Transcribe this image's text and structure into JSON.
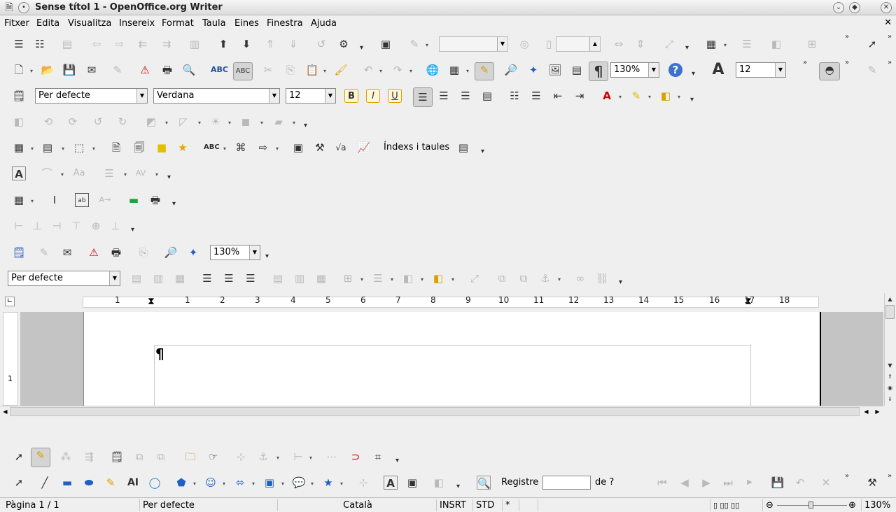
{
  "window": {
    "title": "Sense títol 1 - OpenOffice.org Writer"
  },
  "menu": {
    "items": [
      "Fitxer",
      "Edita",
      "Visualitza",
      "Insereix",
      "Format",
      "Taula",
      "Eines",
      "Finestra",
      "Ajuda"
    ]
  },
  "standard_toolbar": {
    "zoom": "130%",
    "font_size": "12"
  },
  "formatting": {
    "style": "Per defecte",
    "font": "Verdana",
    "size": "12",
    "bold": "B",
    "italic": "I",
    "underline": "U"
  },
  "insert_toolbar": {
    "indexes_label": "Índexs i taules"
  },
  "zoom_toolbar": {
    "zoom": "130%"
  },
  "frame_toolbar": {
    "style": "Per defecte"
  },
  "ruler": {
    "labels": [
      "1",
      "1",
      "2",
      "3",
      "4",
      "5",
      "6",
      "7",
      "8",
      "9",
      "10",
      "11",
      "12",
      "13",
      "14",
      "15",
      "16",
      "17",
      "18"
    ]
  },
  "document": {
    "pilcrow": "¶",
    "vruler_mark": "1"
  },
  "find_bar": {
    "label": "Registre",
    "of_label": "de ?",
    "value": ""
  },
  "status": {
    "page": "Pàgina  1 / 1",
    "style": "Per defecte",
    "language": "Català",
    "insert_mode": "INSRT",
    "selection_mode": "STD",
    "modified": "*",
    "zoom": "130%"
  }
}
